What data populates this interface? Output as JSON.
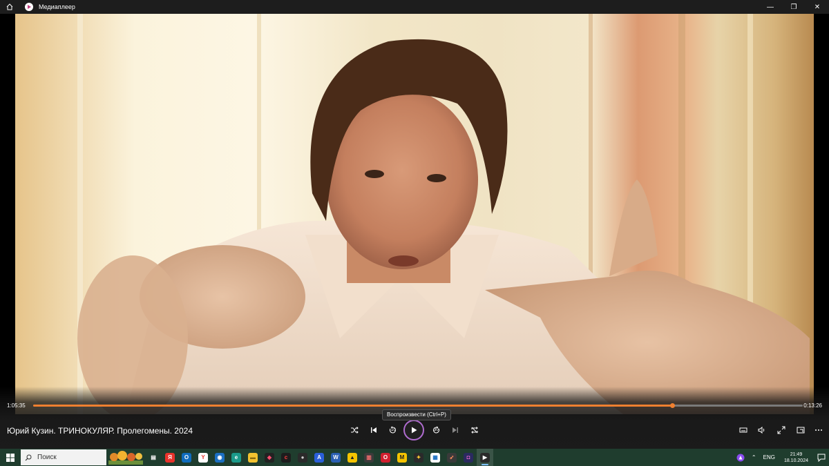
{
  "window": {
    "title": "Медиаплеер",
    "minimize_glyph": "—",
    "restore_glyph": "❐",
    "close_glyph": "✕"
  },
  "player": {
    "elapsed": "1:05:35",
    "remaining": "0:13:26",
    "progress": 0.83,
    "media_title": "Юрий Кузин. ТРИНОКУЛЯР. Пролегомены. 2024",
    "play_tooltip": "Воспроизвести (Ctrl+P)",
    "skip_back_label": "10",
    "skip_forward_label": "30",
    "accent_color": "#f08030",
    "play_ring_color": "#b06cd0"
  },
  "taskbar": {
    "search_placeholder": "Поиск",
    "apps": [
      {
        "name": "task-view-icon",
        "glyph": "▤",
        "bg": "transparent",
        "fg": "#ffffff"
      },
      {
        "name": "yandex-icon",
        "glyph": "Я",
        "bg": "#e8322b",
        "fg": "#ffffff"
      },
      {
        "name": "outlook-icon",
        "glyph": "O",
        "bg": "#0f6cbd",
        "fg": "#ffffff"
      },
      {
        "name": "yandex-browser-icon",
        "glyph": "Y",
        "bg": "#ffffff",
        "fg": "#e8322b"
      },
      {
        "name": "app-blue-icon",
        "glyph": "◉",
        "bg": "#1b6fc2",
        "fg": "#ffffff"
      },
      {
        "name": "edge-icon",
        "glyph": "e",
        "bg": "#1b9a8a",
        "fg": "#ffffff"
      },
      {
        "name": "file-explorer-icon",
        "glyph": "▬",
        "bg": "#f2c230",
        "fg": "#8a6a10"
      },
      {
        "name": "app-dark-icon",
        "glyph": "◆",
        "bg": "#222222",
        "fg": "#ff4d6d"
      },
      {
        "name": "app-red-icon",
        "glyph": "c",
        "bg": "#1d1d1d",
        "fg": "#ff3b3b"
      },
      {
        "name": "app-globe-icon",
        "glyph": "●",
        "bg": "#2a2a2a",
        "fg": "#cccccc"
      },
      {
        "name": "app-a-icon",
        "glyph": "A",
        "bg": "#2b5fd9",
        "fg": "#ffffff"
      },
      {
        "name": "word-icon",
        "glyph": "W",
        "bg": "#2b5fb3",
        "fg": "#ffffff"
      },
      {
        "name": "app-yellow-icon",
        "glyph": "▲",
        "bg": "#f5c400",
        "fg": "#222222"
      },
      {
        "name": "audio-editor-icon",
        "glyph": "▥",
        "bg": "#3b3b3b",
        "fg": "#ff7070"
      },
      {
        "name": "opera-icon",
        "glyph": "O",
        "bg": "#d01f2f",
        "fg": "#ffffff"
      },
      {
        "name": "app-m-icon",
        "glyph": "M",
        "bg": "#f5c400",
        "fg": "#222222"
      },
      {
        "name": "app-star-icon",
        "glyph": "✦",
        "bg": "#2a2a2a",
        "fg": "#ffcc33"
      },
      {
        "name": "store-icon",
        "glyph": "▦",
        "bg": "#ffffff",
        "fg": "#1b6fc2"
      },
      {
        "name": "app-rocket-icon",
        "glyph": "➶",
        "bg": "#3a3a3a",
        "fg": "#ff8c5a"
      },
      {
        "name": "app-game-icon",
        "glyph": "◘",
        "bg": "#2a2a60",
        "fg": "#ff6ad5"
      },
      {
        "name": "media-player-icon",
        "glyph": "▶",
        "bg": "#2a2a2a",
        "fg": "#ffffff",
        "active": true
      }
    ],
    "language": "ENG",
    "time": "21:49",
    "date": "18.10.2024"
  }
}
